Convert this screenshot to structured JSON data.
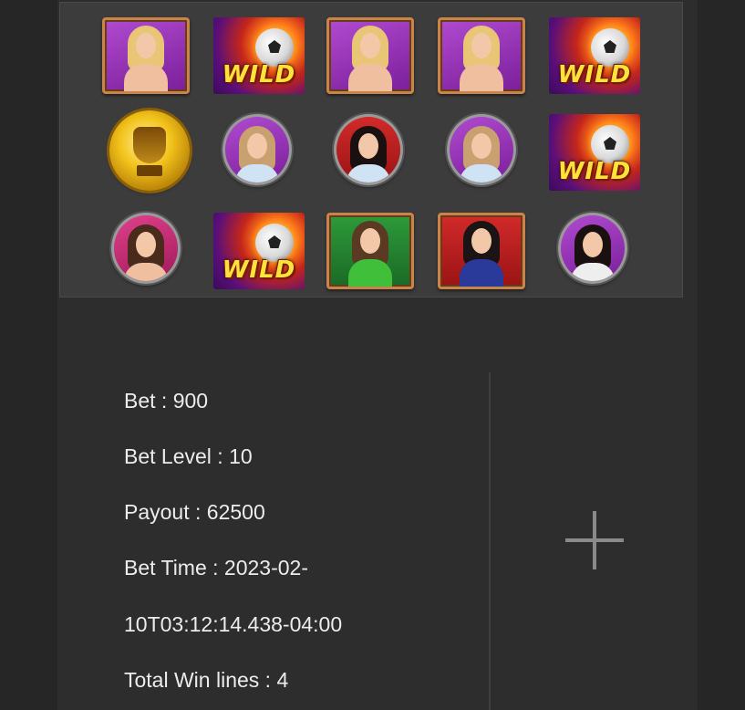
{
  "reels": {
    "symbols": [
      [
        "girl-portrait",
        "wild",
        "girl-portrait",
        "girl-portrait",
        "wild"
      ],
      [
        "trophy-coin",
        "girl-coin",
        "girl-coin",
        "girl-coin",
        "wild"
      ],
      [
        "girl-coin",
        "wild",
        "girl-portrait",
        "girl-portrait",
        "girl-coin"
      ]
    ],
    "wild_label": "WILD"
  },
  "details": {
    "bet": "Bet : 900",
    "bet_level": "Bet Level : 10",
    "payout": "Payout : 62500",
    "bet_time_line1": "Bet Time : 2023-02-",
    "bet_time_line2": "10T03:12:14.438-04:00",
    "total_win_lines": "Total Win lines : 4"
  },
  "expand_icon": "plus-icon",
  "colors": {
    "background": "#2a2a2a",
    "reel_bg": "#3c3c3c",
    "text": "#ececec",
    "wild_text": "#ffe23a",
    "frame": "#c9844b"
  }
}
